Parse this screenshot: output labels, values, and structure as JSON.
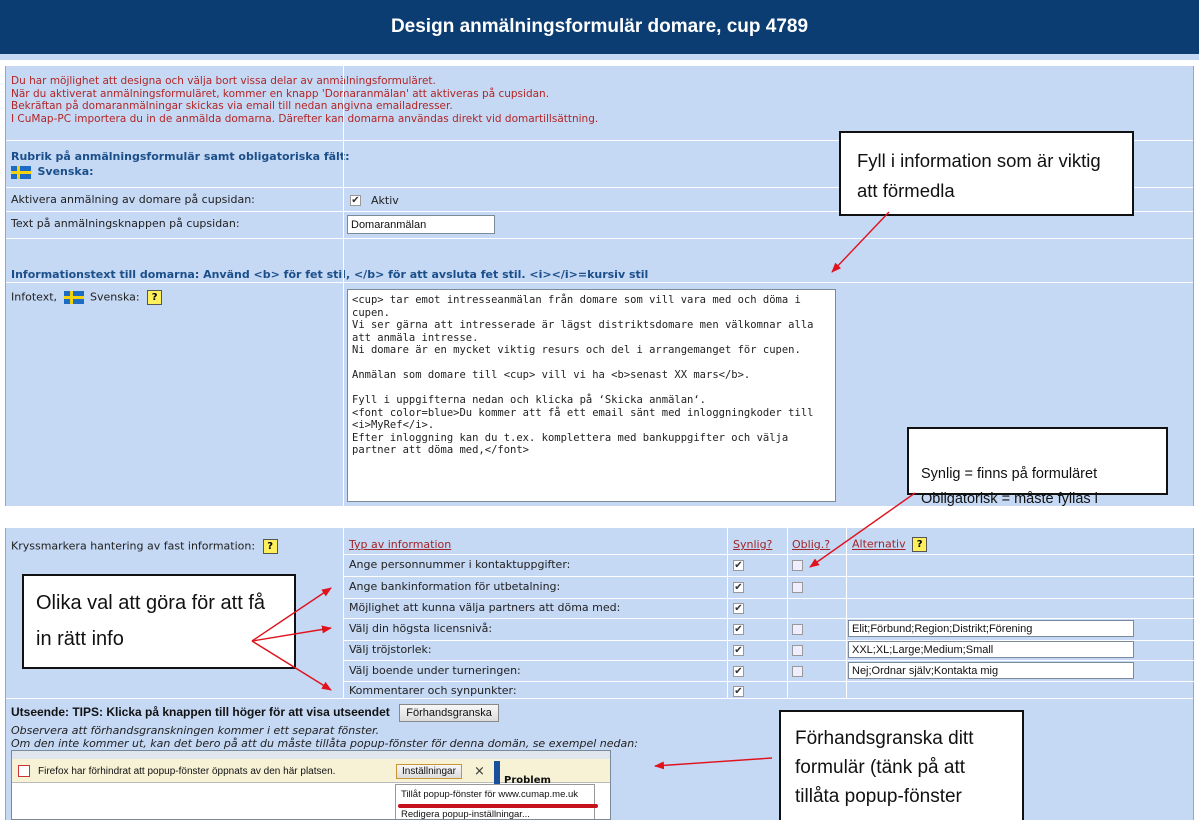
{
  "page_title": "Design anmälningsformulär domare, cup 4789",
  "intro_lines": [
    "Du har möjlighet att designa och välja bort vissa delar av anmälningsformuläret.",
    "När du aktiverat anmälningsformuläret, kommer en knapp 'Domaranmälan' att aktiveras på cupsidan.",
    "Bekräftan på domaranmälningar skickas via email till nedan angivna emailadresser.",
    "I CuMap-PC importera du in de anmälda domarna. Därefter kan domarna användas direkt vid domartillsättning."
  ],
  "rubrik_heading": "Rubrik på anmälningsformulär samt obligatoriska fält:",
  "svenska_label": "Svenska:",
  "activate_label": "Aktivera anmälning av domare på cupsidan:",
  "activate_checkbox": "✔",
  "activate_value": "Aktiv",
  "button_text_label": "Text på anmälningsknappen på cupsidan:",
  "button_text_value": "Domaranmälan",
  "info_heading": "Informationstext till domarna:  Använd <b> för fet stil, </b> för att avsluta fet stil.  <i></i>=kursiv stil",
  "infotext_label": "Infotext,",
  "infotext_label2": "Svenska:",
  "help_glyph": "?",
  "infotext_value": "<cup> tar emot intresseanmälan från domare som vill vara med och döma i cupen.\nVi ser gärna att intresserade är lägst distriktsdomare men välkomnar alla att anmäla intresse.\nNi domare är en mycket viktig resurs och del i arrangemanget för cupen.\n\nAnmälan som domare till <cup> vill vi ha <b>senast XX mars</b>.\n\nFyll i uppgifterna nedan och klicka på ‘Skicka anmälan‘.\n<font color=blue>Du kommer att få ett email sänt med inloggningkoder till <i>MyRef</i>.\nEfter inloggning kan du t.ex. komplettera med bankuppgifter och välja partner att döma med,</font>",
  "fixed_info_label": "Kryssmarkera hantering av fast information:",
  "table": {
    "headers": [
      "Typ av information",
      "Synlig?",
      "Oblig.?",
      "Alternativ"
    ],
    "rows": [
      {
        "label": "Ange personnummer i kontaktuppgifter:",
        "synlig": "✔",
        "oblig": "",
        "alt": ""
      },
      {
        "label": "Ange bankinformation för utbetalning:",
        "synlig": "✔",
        "oblig": "",
        "alt": ""
      },
      {
        "label": "Möjlighet att kunna välja partners att döma med:",
        "synlig": "✔",
        "oblig": "",
        "alt": ""
      },
      {
        "label": "Välj din högsta licensnivå:",
        "synlig": "✔",
        "oblig": "",
        "alt": "Elit;Förbund;Region;Distrikt;Förening"
      },
      {
        "label": "Välj tröjstorlek:",
        "synlig": "✔",
        "oblig": "",
        "alt": "XXL;XL;Large;Medium;Small"
      },
      {
        "label": "Välj boende under turneringen:",
        "synlig": "✔",
        "oblig": "",
        "alt": "Nej;Ordnar själv;Kontakta mig"
      },
      {
        "label": "Kommentarer och synpunkter:",
        "synlig": "✔",
        "oblig": "",
        "alt": ""
      }
    ]
  },
  "preview_heading": "Utseende: TIPS: Klicka på knappen till höger för att visa utseendet",
  "preview_button": "Förhandsgranska",
  "preview_note1": "Observera att förhandsgranskningen kommer i ett separat fönster.",
  "preview_note2": "Om den inte kommer ut, kan det bero på att du måste tillåta popup-fönster för denna domän, se exempel nedan:",
  "firefox": {
    "message": "Firefox har förhindrat att popup-fönster öppnats av den här platsen.",
    "settings_button": "Inställningar",
    "close": "×",
    "menu_allow": "Tillåt popup-fönster för www.cumap.me.uk",
    "menu_edit": "Redigera popup-inställningar...",
    "problem_label": "Problem"
  },
  "callouts": {
    "fyll": "Fyll i information som är viktig att förmedla",
    "synlig": "Synlig = finns på formuläret\nObligatorisk = måste fyllas i",
    "olika": "Olika val att göra för att få in rätt info",
    "forhand": "Förhandsgranska ditt formulär (tänk på att tillåta popup-fönster"
  },
  "colors": {
    "title_bg": "#0b3d73",
    "panel_bg": "#c5d8f4",
    "intro_text": "#b22626",
    "section_text": "#1b4f8a",
    "arrow": "#e0121c"
  }
}
